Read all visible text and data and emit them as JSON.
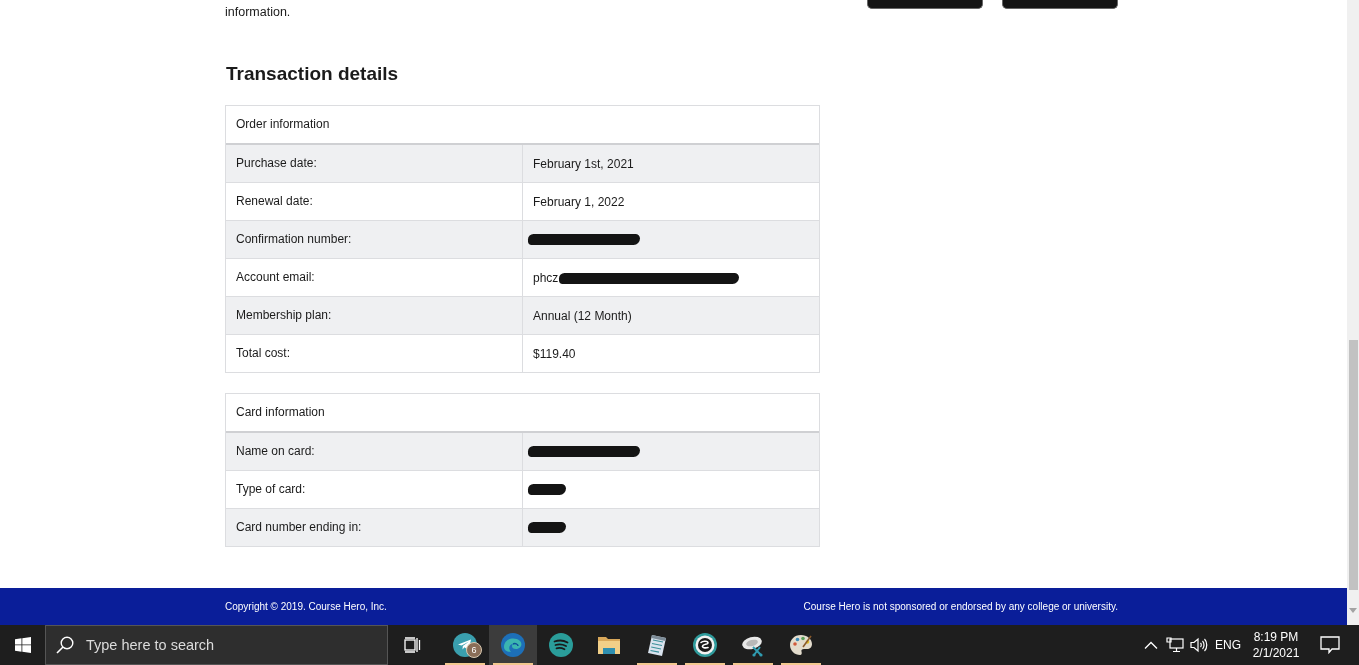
{
  "page_text": "information.",
  "heading": "Transaction details",
  "tables": [
    {
      "title": "Order information",
      "rows": [
        {
          "label": "Purchase date:",
          "value": "February 1st, 2021",
          "kind": "plain"
        },
        {
          "label": "Renewal date:",
          "value": "February 1, 2022",
          "kind": "plain"
        },
        {
          "label": "Confirmation number:",
          "kind": "medium"
        },
        {
          "label": "Account email:",
          "value": "phcz",
          "kind": "long"
        },
        {
          "label": "Membership plan:",
          "value": "Annual (12 Month)",
          "kind": "plain"
        },
        {
          "label": "Total cost:",
          "value": "$119.40",
          "kind": "plain"
        }
      ]
    },
    {
      "title": "Card information",
      "rows": [
        {
          "label": "Name on card:",
          "kind": "medium"
        },
        {
          "label": "Type of card:",
          "kind": "short"
        },
        {
          "label": "Card number ending in:",
          "kind": "short"
        }
      ]
    }
  ],
  "footer": {
    "copyright": "Copyright © 2019. Course Hero, Inc.",
    "disclaimer": "Course Hero is not sponsored or endorsed by any college or university."
  },
  "taskbar": {
    "search": {
      "placeholder": "Type here to search"
    },
    "apps": [
      {
        "kind": "messenger",
        "running": true,
        "selected": false,
        "badge": "6"
      },
      {
        "kind": "browser",
        "running": true,
        "selected": true
      },
      {
        "kind": "music",
        "running": false,
        "selected": false
      },
      {
        "kind": "files",
        "running": false,
        "selected": false
      },
      {
        "kind": "notes",
        "running": true,
        "selected": false
      },
      {
        "kind": "swirl",
        "running": true,
        "selected": false
      },
      {
        "kind": "dish",
        "running": true,
        "selected": false
      },
      {
        "kind": "paint",
        "running": true,
        "selected": false
      }
    ],
    "tray": {
      "language": "ENG",
      "time": "8:19 PM",
      "date": "2/1/2021"
    }
  }
}
